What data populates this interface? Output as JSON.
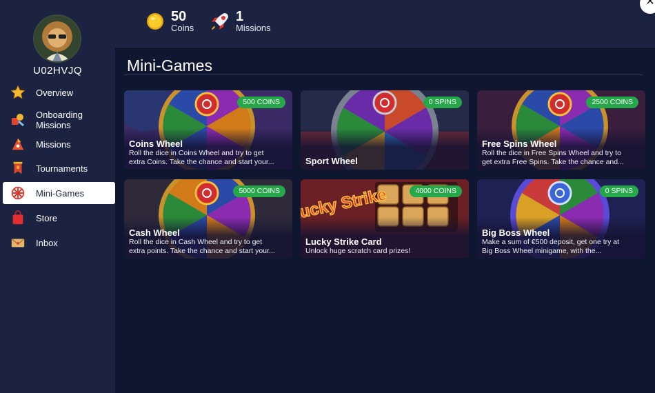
{
  "user": {
    "username": "U02HVJQ"
  },
  "stats": {
    "coins": {
      "value": "50",
      "label": "Coins"
    },
    "missions": {
      "value": "1",
      "label": "Missions"
    }
  },
  "nav": [
    {
      "label": "Overview",
      "icon": "star-icon"
    },
    {
      "label": "Onboarding Missions",
      "icon": "onboarding-icon"
    },
    {
      "label": "Missions",
      "icon": "missions-icon"
    },
    {
      "label": "Tournaments",
      "icon": "banner-icon"
    },
    {
      "label": "Mini-Games",
      "icon": "wheel-icon",
      "active": true
    },
    {
      "label": "Store",
      "icon": "shopping-bag-icon"
    },
    {
      "label": "Inbox",
      "icon": "envelope-icon"
    }
  ],
  "page_title": "Mini-Games",
  "cards": [
    {
      "name": "Coins Wheel",
      "badge": "500 COINS",
      "desc1": "Roll the dice in Coins Wheel and try to get",
      "desc2": "extra Coins. Take the chance and start your..."
    },
    {
      "name": "Sport Wheel",
      "badge": "0 SPINS",
      "desc1": "",
      "desc2": ""
    },
    {
      "name": "Free Spins Wheel",
      "badge": "2500 COINS",
      "desc1": "Roll the dice in Free Spins Wheel and try to",
      "desc2": "get extra Free Spins. Take the chance and..."
    },
    {
      "name": "Cash Wheel",
      "badge": "5000 COINS",
      "desc1": "Roll the dice in Cash Wheel and try to get",
      "desc2": "extra points. Take the chance and start your..."
    },
    {
      "name": "Lucky Strike Card",
      "badge": "4000 COINS",
      "desc1": "Unlock huge scratch card prizes!",
      "desc2": ""
    },
    {
      "name": "Big Boss Wheel",
      "badge": "0 SPINS",
      "desc1": "Make a sum of €500 deposit, get one try at",
      "desc2": "Big Boss Wheel minigame, with the..."
    }
  ],
  "lucky_strike_logo": "Lucky Strike",
  "colors": {
    "sidebar": "#1b2340",
    "main": "#0f1630",
    "badge": "#26a84a",
    "active_nav": "#ffffff"
  }
}
